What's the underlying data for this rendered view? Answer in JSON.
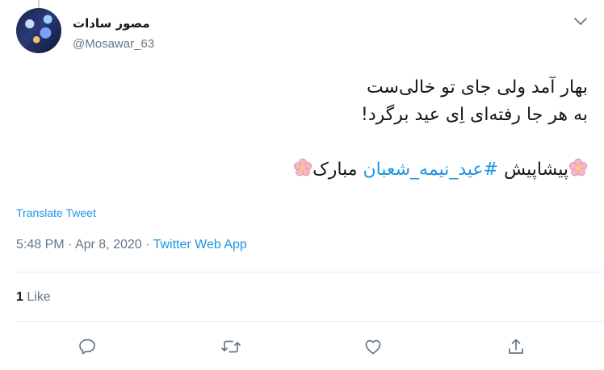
{
  "tweet": {
    "author_name": "مصور سادات",
    "author_handle": "@Mosawar_63",
    "lines": [
      "بهار آمد ولی جای تو خالی‌ست",
      "به هر جا رفته‌ای اِی عید برگرد!"
    ],
    "line3_prefix": "پیشاپیش ",
    "hashtag": "#عید_نیمه_شعبان",
    "line3_suffix": " مبارک",
    "emoji": "cherry-blossom-icon"
  },
  "translate_label": "Translate Tweet",
  "meta": {
    "time": "5:48 PM",
    "separator": " · ",
    "date": "Apr 8, 2020",
    "source": "Twitter Web App"
  },
  "likes": {
    "count": "1",
    "label": "Like"
  },
  "colors": {
    "link": "#1b95e0",
    "muted": "#657786",
    "text": "#14171a",
    "divider": "#e6ecf0"
  }
}
